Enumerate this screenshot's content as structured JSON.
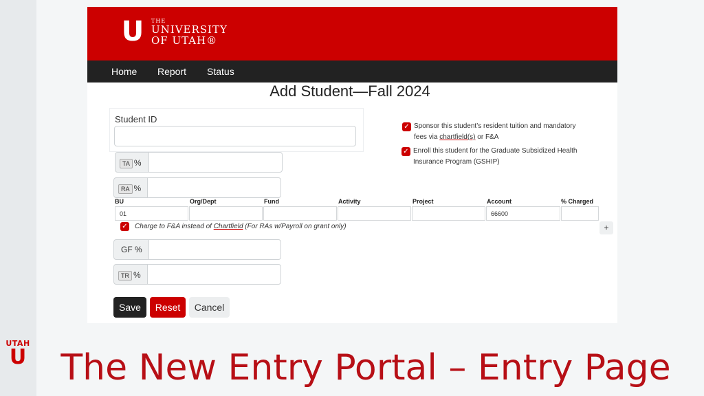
{
  "brand": {
    "the": "THE",
    "line1": "UNIVERSITY",
    "line2": "OF UTAH®",
    "side_word": "UTAH",
    "side_u": "U",
    "u_letter": "U"
  },
  "nav": {
    "items": [
      "Home",
      "Report",
      "Status"
    ]
  },
  "page": {
    "title": "Add Student—Fall 2024"
  },
  "form": {
    "student_id_label": "Student ID",
    "ta_tag": "TA",
    "ra_tag": "RA",
    "tr_tag": "TR",
    "pct": "%",
    "gf_label": "GF %",
    "sponsor_text_1": "Sponsor this student’s resident tuition and mandatory",
    "sponsor_text_2a": "fees via ",
    "sponsor_text_2b": "chartfield(s)",
    "sponsor_text_2c": " or F&A",
    "enroll_text_1": "Enroll this student for the Graduate Subsidized Health",
    "enroll_text_2": "Insurance Program (GSHIP)",
    "columns": [
      "BU",
      "Org/Dept",
      "Fund",
      "Activity",
      "Project",
      "Account",
      "% Charged"
    ],
    "row_values": [
      "01",
      "",
      "",
      "",
      "",
      "66600",
      ""
    ],
    "charge_text_a": "Charge to F&A instead of ",
    "charge_text_b": "Chartfield",
    "charge_text_c": " (For RAs w/Payroll on grant only)",
    "add_symbol": "+",
    "checked": "✓"
  },
  "buttons": {
    "save": "Save",
    "reset": "Reset",
    "cancel": "Cancel"
  },
  "colors": {
    "brand_red": "#cc0000",
    "nav_bg": "#222222",
    "footer_red": "#b70f16"
  },
  "footer": {
    "title": "The New Entry Portal – Entry Page"
  }
}
